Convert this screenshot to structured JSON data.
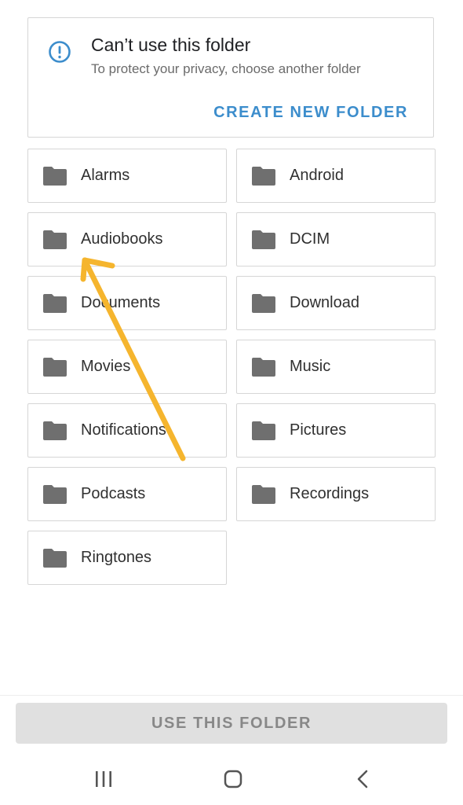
{
  "notice": {
    "title": "Can’t use this folder",
    "subtitle": "To protect your privacy, choose another folder",
    "create_label": "CREATE NEW FOLDER",
    "icon": "info-icon"
  },
  "folders": [
    {
      "label": "Alarms"
    },
    {
      "label": "Android"
    },
    {
      "label": "Audiobooks"
    },
    {
      "label": "DCIM"
    },
    {
      "label": "Documents"
    },
    {
      "label": "Download"
    },
    {
      "label": "Movies"
    },
    {
      "label": "Music"
    },
    {
      "label": "Notifications"
    },
    {
      "label": "Pictures"
    },
    {
      "label": "Podcasts"
    },
    {
      "label": "Recordings"
    },
    {
      "label": "Ringtones"
    }
  ],
  "use_button": {
    "label": "USE THIS FOLDER",
    "enabled": false
  },
  "nav": {
    "items": [
      "recents-icon",
      "home-icon",
      "back-icon"
    ]
  },
  "colors": {
    "accent": "#3c8dcc",
    "folder_icon": "#6f6f6f",
    "annotation_arrow": "#f5b52e",
    "disabled_button": "#e0e0e0"
  }
}
